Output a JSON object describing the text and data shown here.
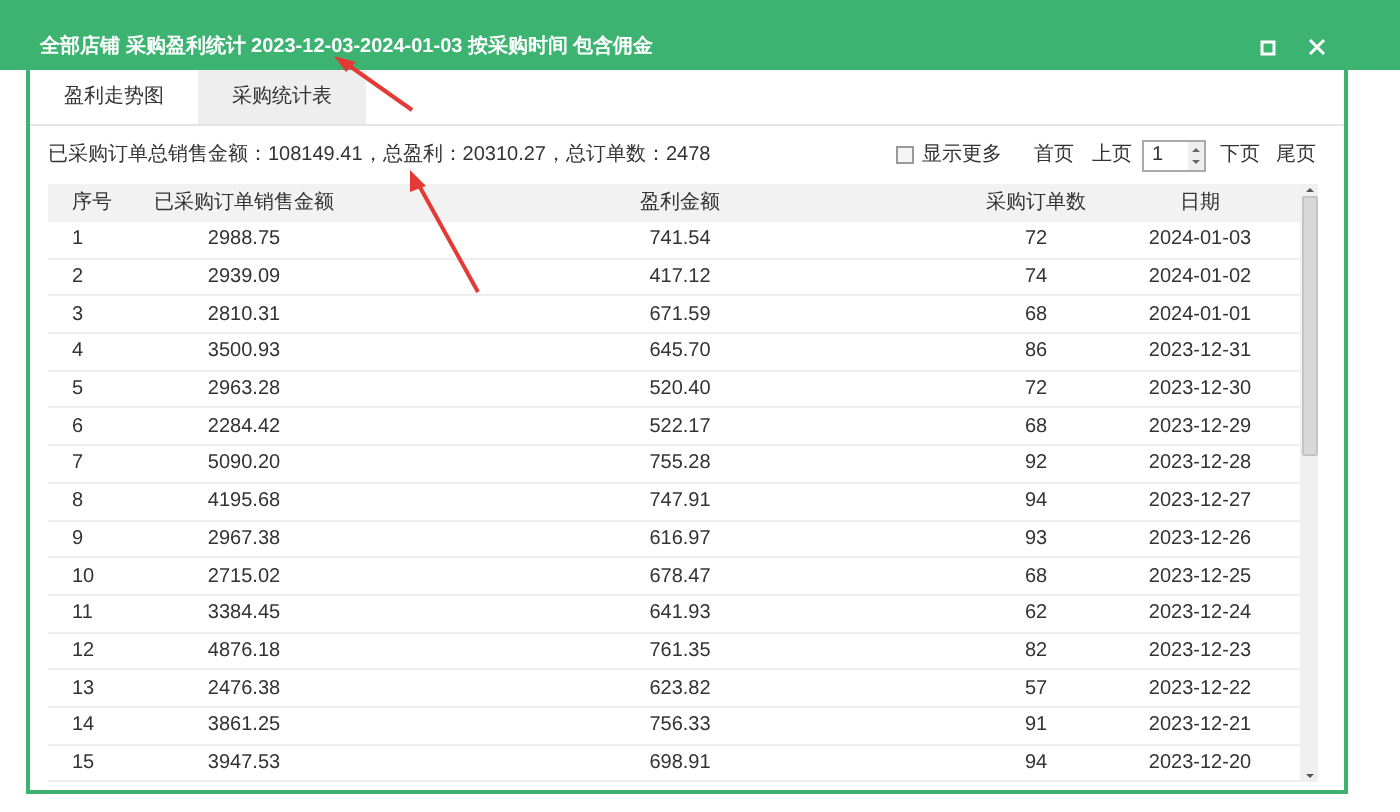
{
  "window": {
    "title": "全部店铺 采购盈利统计 2023-12-03-2024-01-03 按采购时间 包含佣金"
  },
  "tabs": [
    {
      "label": "盈利走势图",
      "selected": false
    },
    {
      "label": "采购统计表",
      "selected": true
    }
  ],
  "summary": "已采购订单总销售金额：108149.41，总盈利：20310.27，总订单数：2478",
  "show_more": {
    "label": "显示更多",
    "checked": false
  },
  "pager": {
    "first": "首页",
    "prev": "上页",
    "page": "1",
    "next": "下页",
    "last": "尾页"
  },
  "table": {
    "columns": [
      "序号",
      "已采购订单销售金额",
      "盈利金额",
      "采购订单数",
      "日期"
    ],
    "rows": [
      [
        "1",
        "2988.75",
        "741.54",
        "72",
        "2024-01-03"
      ],
      [
        "2",
        "2939.09",
        "417.12",
        "74",
        "2024-01-02"
      ],
      [
        "3",
        "2810.31",
        "671.59",
        "68",
        "2024-01-01"
      ],
      [
        "4",
        "3500.93",
        "645.70",
        "86",
        "2023-12-31"
      ],
      [
        "5",
        "2963.28",
        "520.40",
        "72",
        "2023-12-30"
      ],
      [
        "6",
        "2284.42",
        "522.17",
        "68",
        "2023-12-29"
      ],
      [
        "7",
        "5090.20",
        "755.28",
        "92",
        "2023-12-28"
      ],
      [
        "8",
        "4195.68",
        "747.91",
        "94",
        "2023-12-27"
      ],
      [
        "9",
        "2967.38",
        "616.97",
        "93",
        "2023-12-26"
      ],
      [
        "10",
        "2715.02",
        "678.47",
        "68",
        "2023-12-25"
      ],
      [
        "11",
        "3384.45",
        "641.93",
        "62",
        "2023-12-24"
      ],
      [
        "12",
        "4876.18",
        "761.35",
        "82",
        "2023-12-23"
      ],
      [
        "13",
        "2476.38",
        "623.82",
        "57",
        "2023-12-22"
      ],
      [
        "14",
        "3861.25",
        "756.33",
        "91",
        "2023-12-21"
      ],
      [
        "15",
        "3947.53",
        "698.91",
        "94",
        "2023-12-20"
      ]
    ]
  }
}
